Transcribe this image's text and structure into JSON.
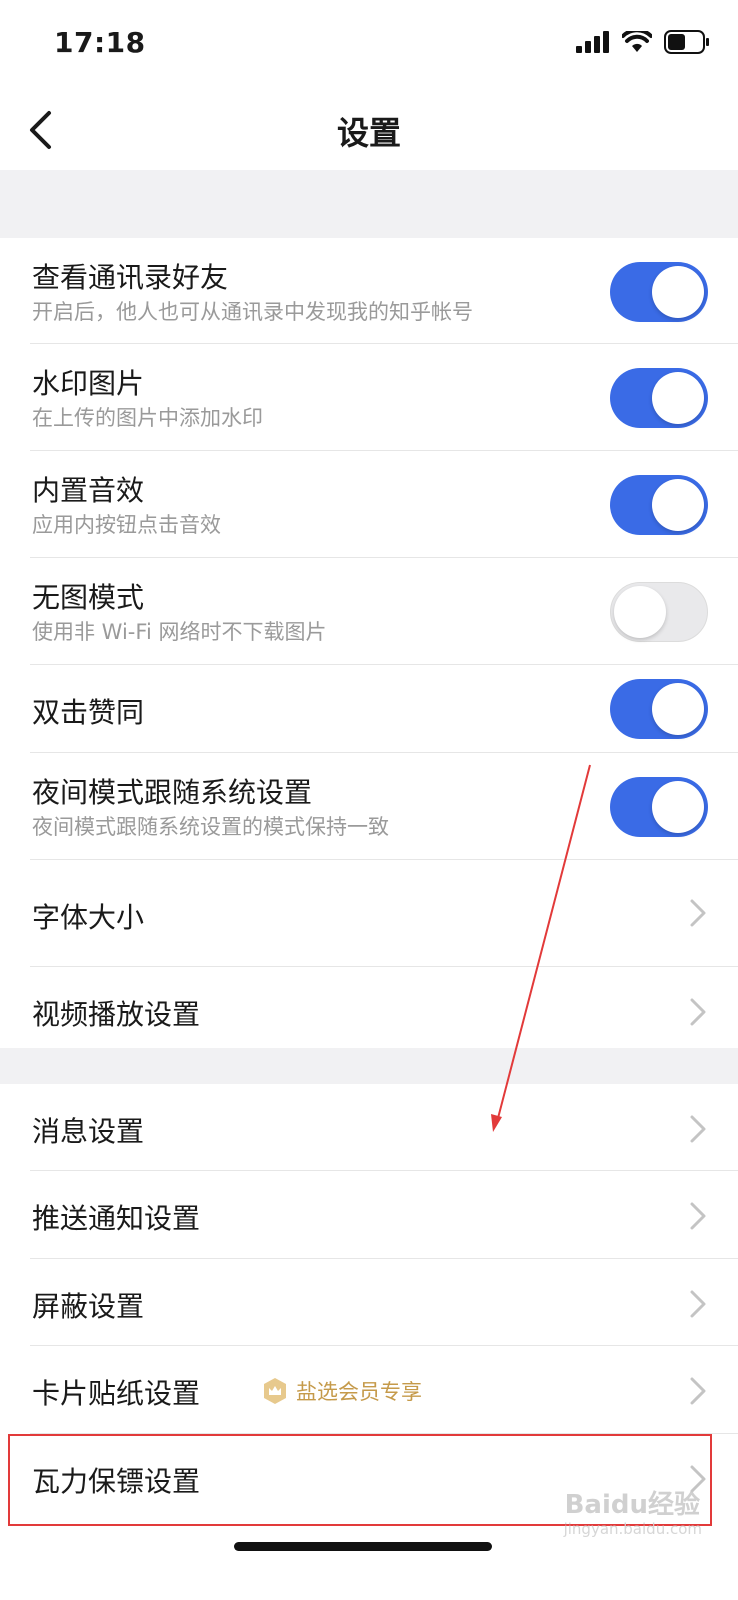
{
  "status_bar": {
    "time": "17:18"
  },
  "nav": {
    "title": "设置"
  },
  "section1": {
    "rows": [
      {
        "title": "查看通讯录好友",
        "subtitle": "开启后，他人也可从通讯录中发现我的知乎帐号",
        "toggle": "on"
      },
      {
        "title": "水印图片",
        "subtitle": "在上传的图片中添加水印",
        "toggle": "on"
      },
      {
        "title": "内置音效",
        "subtitle": "应用内按钮点击音效",
        "toggle": "on"
      },
      {
        "title": "无图模式",
        "subtitle": "使用非 Wi-Fi 网络时不下载图片",
        "toggle": "off"
      },
      {
        "title": "双击赞同",
        "toggle": "on"
      },
      {
        "title": "夜间模式跟随系统设置",
        "subtitle": "夜间模式跟随系统设置的模式保持一致",
        "toggle": "on"
      },
      {
        "title": "字体大小"
      },
      {
        "title": "视频播放设置"
      }
    ]
  },
  "section2": {
    "rows": [
      {
        "title": "消息设置"
      },
      {
        "title": "推送通知设置"
      },
      {
        "title": "屏蔽设置"
      },
      {
        "title": "卡片贴纸设置",
        "badge": "盐选会员专享"
      },
      {
        "title": "瓦力保镖设置"
      }
    ]
  },
  "watermark": {
    "brand": "Baidu经验",
    "url": "jingyan.baidu.com"
  },
  "colors": {
    "toggle_on": "#3a6be6",
    "badge": "#c59a4a",
    "highlight": "#e23a3a"
  }
}
